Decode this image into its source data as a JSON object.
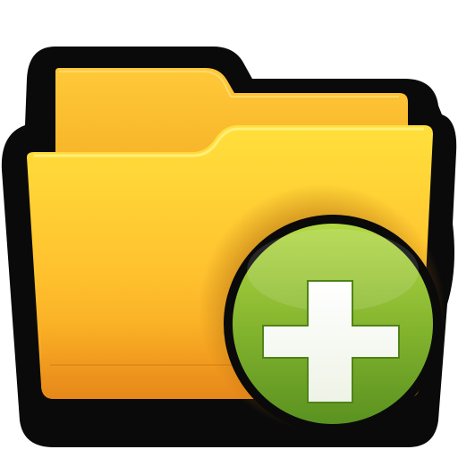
{
  "icon": {
    "name": "add-folder-icon",
    "parts": [
      "folder-icon",
      "plus-icon"
    ]
  },
  "colors": {
    "outline": "#0a0a0a",
    "folder_back": "#f2a61e",
    "folder_front_top": "#ffd93a",
    "folder_front_bottom": "#f39a1c",
    "badge_top": "#a7cf3c",
    "badge_bottom": "#5f9a22",
    "plus": "#ffffff"
  }
}
